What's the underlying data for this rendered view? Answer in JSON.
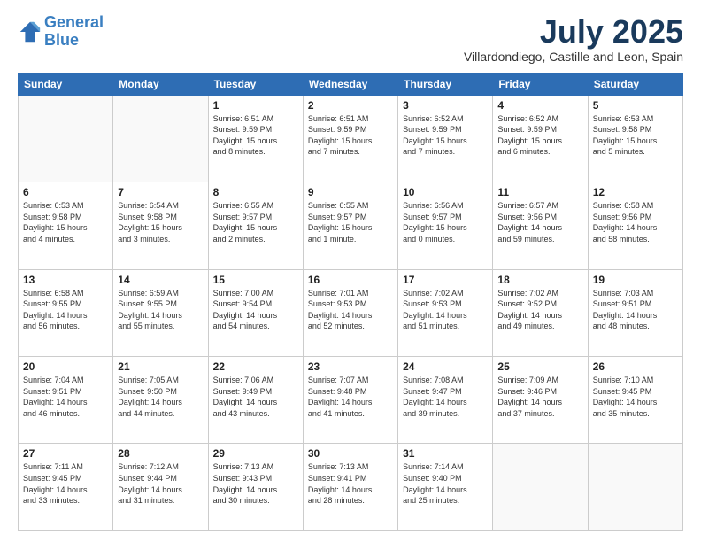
{
  "logo": {
    "line1": "General",
    "line2": "Blue"
  },
  "header": {
    "month": "July 2025",
    "location": "Villardondiego, Castille and Leon, Spain"
  },
  "weekdays": [
    "Sunday",
    "Monday",
    "Tuesday",
    "Wednesday",
    "Thursday",
    "Friday",
    "Saturday"
  ],
  "weeks": [
    [
      {
        "day": "",
        "info": ""
      },
      {
        "day": "",
        "info": ""
      },
      {
        "day": "1",
        "info": "Sunrise: 6:51 AM\nSunset: 9:59 PM\nDaylight: 15 hours\nand 8 minutes."
      },
      {
        "day": "2",
        "info": "Sunrise: 6:51 AM\nSunset: 9:59 PM\nDaylight: 15 hours\nand 7 minutes."
      },
      {
        "day": "3",
        "info": "Sunrise: 6:52 AM\nSunset: 9:59 PM\nDaylight: 15 hours\nand 7 minutes."
      },
      {
        "day": "4",
        "info": "Sunrise: 6:52 AM\nSunset: 9:59 PM\nDaylight: 15 hours\nand 6 minutes."
      },
      {
        "day": "5",
        "info": "Sunrise: 6:53 AM\nSunset: 9:58 PM\nDaylight: 15 hours\nand 5 minutes."
      }
    ],
    [
      {
        "day": "6",
        "info": "Sunrise: 6:53 AM\nSunset: 9:58 PM\nDaylight: 15 hours\nand 4 minutes."
      },
      {
        "day": "7",
        "info": "Sunrise: 6:54 AM\nSunset: 9:58 PM\nDaylight: 15 hours\nand 3 minutes."
      },
      {
        "day": "8",
        "info": "Sunrise: 6:55 AM\nSunset: 9:57 PM\nDaylight: 15 hours\nand 2 minutes."
      },
      {
        "day": "9",
        "info": "Sunrise: 6:55 AM\nSunset: 9:57 PM\nDaylight: 15 hours\nand 1 minute."
      },
      {
        "day": "10",
        "info": "Sunrise: 6:56 AM\nSunset: 9:57 PM\nDaylight: 15 hours\nand 0 minutes."
      },
      {
        "day": "11",
        "info": "Sunrise: 6:57 AM\nSunset: 9:56 PM\nDaylight: 14 hours\nand 59 minutes."
      },
      {
        "day": "12",
        "info": "Sunrise: 6:58 AM\nSunset: 9:56 PM\nDaylight: 14 hours\nand 58 minutes."
      }
    ],
    [
      {
        "day": "13",
        "info": "Sunrise: 6:58 AM\nSunset: 9:55 PM\nDaylight: 14 hours\nand 56 minutes."
      },
      {
        "day": "14",
        "info": "Sunrise: 6:59 AM\nSunset: 9:55 PM\nDaylight: 14 hours\nand 55 minutes."
      },
      {
        "day": "15",
        "info": "Sunrise: 7:00 AM\nSunset: 9:54 PM\nDaylight: 14 hours\nand 54 minutes."
      },
      {
        "day": "16",
        "info": "Sunrise: 7:01 AM\nSunset: 9:53 PM\nDaylight: 14 hours\nand 52 minutes."
      },
      {
        "day": "17",
        "info": "Sunrise: 7:02 AM\nSunset: 9:53 PM\nDaylight: 14 hours\nand 51 minutes."
      },
      {
        "day": "18",
        "info": "Sunrise: 7:02 AM\nSunset: 9:52 PM\nDaylight: 14 hours\nand 49 minutes."
      },
      {
        "day": "19",
        "info": "Sunrise: 7:03 AM\nSunset: 9:51 PM\nDaylight: 14 hours\nand 48 minutes."
      }
    ],
    [
      {
        "day": "20",
        "info": "Sunrise: 7:04 AM\nSunset: 9:51 PM\nDaylight: 14 hours\nand 46 minutes."
      },
      {
        "day": "21",
        "info": "Sunrise: 7:05 AM\nSunset: 9:50 PM\nDaylight: 14 hours\nand 44 minutes."
      },
      {
        "day": "22",
        "info": "Sunrise: 7:06 AM\nSunset: 9:49 PM\nDaylight: 14 hours\nand 43 minutes."
      },
      {
        "day": "23",
        "info": "Sunrise: 7:07 AM\nSunset: 9:48 PM\nDaylight: 14 hours\nand 41 minutes."
      },
      {
        "day": "24",
        "info": "Sunrise: 7:08 AM\nSunset: 9:47 PM\nDaylight: 14 hours\nand 39 minutes."
      },
      {
        "day": "25",
        "info": "Sunrise: 7:09 AM\nSunset: 9:46 PM\nDaylight: 14 hours\nand 37 minutes."
      },
      {
        "day": "26",
        "info": "Sunrise: 7:10 AM\nSunset: 9:45 PM\nDaylight: 14 hours\nand 35 minutes."
      }
    ],
    [
      {
        "day": "27",
        "info": "Sunrise: 7:11 AM\nSunset: 9:45 PM\nDaylight: 14 hours\nand 33 minutes."
      },
      {
        "day": "28",
        "info": "Sunrise: 7:12 AM\nSunset: 9:44 PM\nDaylight: 14 hours\nand 31 minutes."
      },
      {
        "day": "29",
        "info": "Sunrise: 7:13 AM\nSunset: 9:43 PM\nDaylight: 14 hours\nand 30 minutes."
      },
      {
        "day": "30",
        "info": "Sunrise: 7:13 AM\nSunset: 9:41 PM\nDaylight: 14 hours\nand 28 minutes."
      },
      {
        "day": "31",
        "info": "Sunrise: 7:14 AM\nSunset: 9:40 PM\nDaylight: 14 hours\nand 25 minutes."
      },
      {
        "day": "",
        "info": ""
      },
      {
        "day": "",
        "info": ""
      }
    ]
  ]
}
